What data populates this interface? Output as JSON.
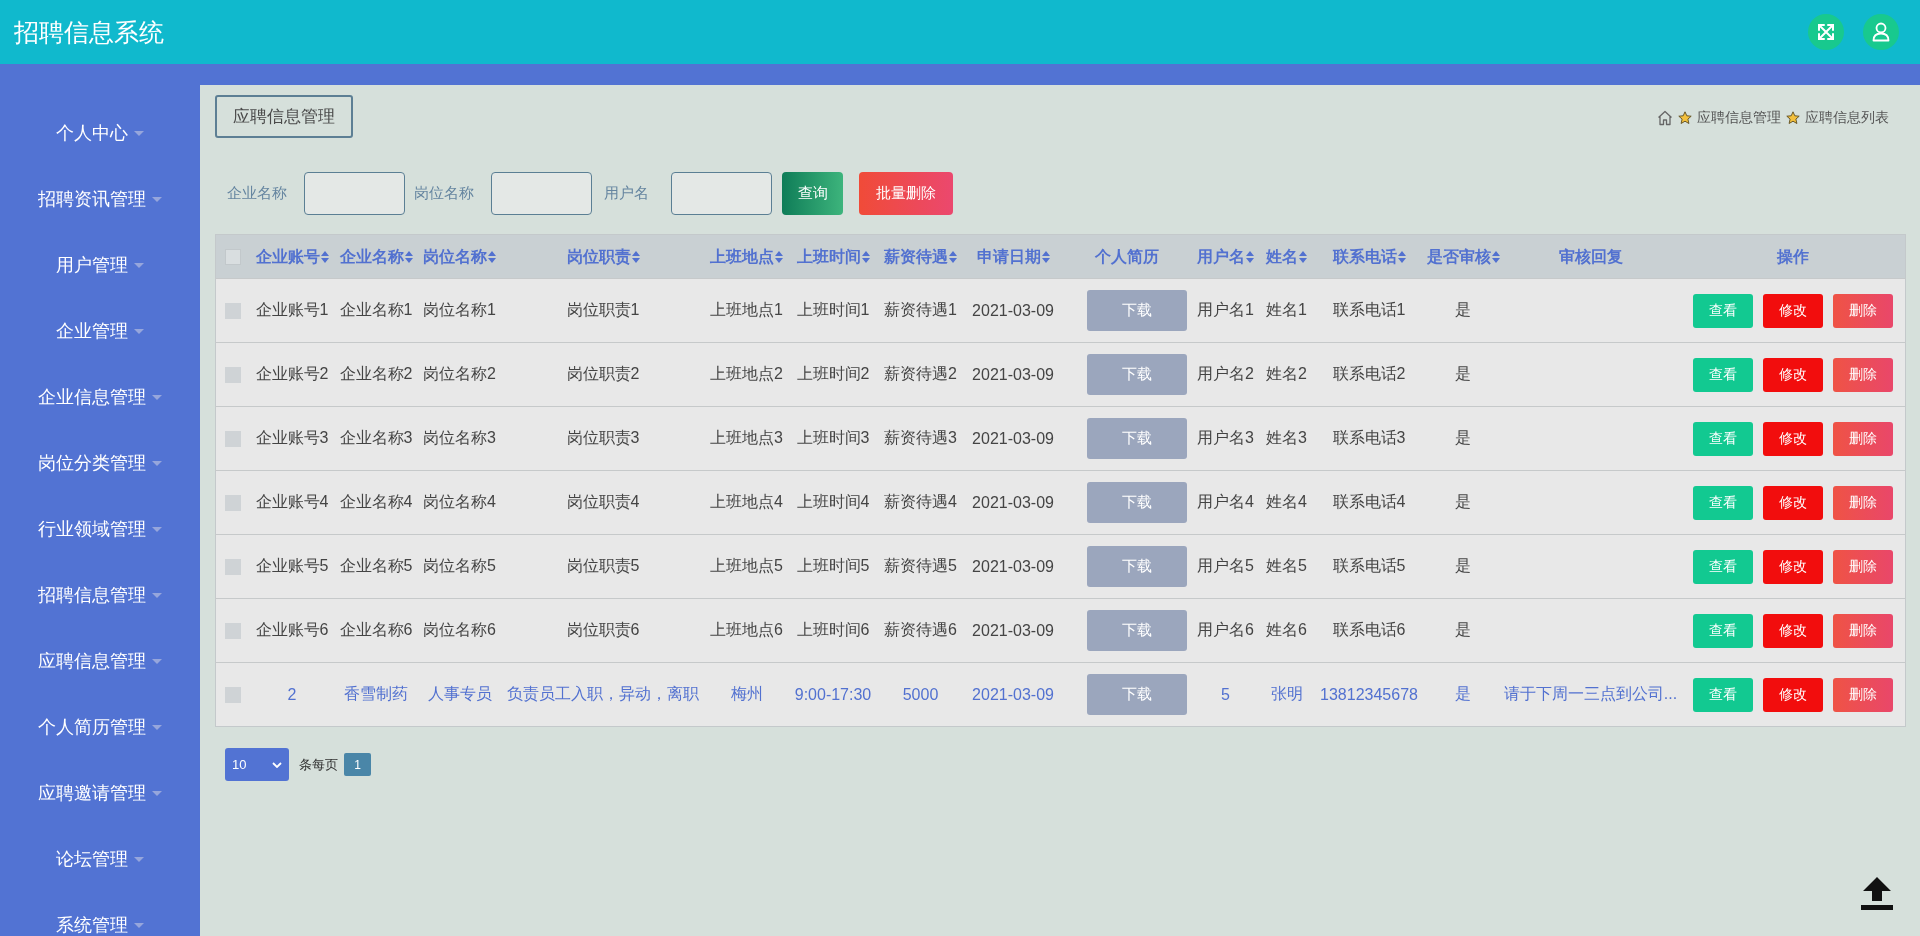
{
  "app": {
    "title": "招聘信息系统"
  },
  "sidebar": {
    "items": [
      {
        "label": "个人中心"
      },
      {
        "label": "招聘资讯管理"
      },
      {
        "label": "用户管理"
      },
      {
        "label": "企业管理"
      },
      {
        "label": "企业信息管理"
      },
      {
        "label": "岗位分类管理"
      },
      {
        "label": "行业领域管理"
      },
      {
        "label": "招聘信息管理"
      },
      {
        "label": "应聘信息管理"
      },
      {
        "label": "个人简历管理"
      },
      {
        "label": "应聘邀请管理"
      },
      {
        "label": "论坛管理"
      },
      {
        "label": "系统管理"
      }
    ]
  },
  "page_title": "应聘信息管理",
  "breadcrumb": [
    {
      "label": "应聘信息管理"
    },
    {
      "label": "应聘信息列表"
    }
  ],
  "search": {
    "fields": [
      {
        "label": "企业名称"
      },
      {
        "label": "岗位名称"
      },
      {
        "label": "用户名"
      }
    ],
    "buttons": [
      {
        "label": "查询",
        "kind": "search"
      },
      {
        "label": "批量删除",
        "kind": "delete"
      }
    ]
  },
  "table": {
    "header_checked": false,
    "columns": [
      {
        "label": "企业账号",
        "sortable": true,
        "kind": "text"
      },
      {
        "label": "企业名称",
        "sortable": true,
        "kind": "text"
      },
      {
        "label": "岗位名称",
        "sortable": true,
        "kind": "text"
      },
      {
        "label": "岗位职责",
        "sortable": true,
        "kind": "text"
      },
      {
        "label": "上班地点",
        "sortable": true,
        "kind": "text"
      },
      {
        "label": "上班时间",
        "sortable": true,
        "kind": "text"
      },
      {
        "label": "薪资待遇",
        "sortable": true,
        "kind": "text"
      },
      {
        "label": "申请日期",
        "sortable": true,
        "kind": "text"
      },
      {
        "label": "个人简历",
        "sortable": false,
        "kind": "button"
      },
      {
        "label": "用户名",
        "sortable": true,
        "kind": "text"
      },
      {
        "label": "姓名",
        "sortable": true,
        "kind": "text"
      },
      {
        "label": "联系电话",
        "sortable": true,
        "kind": "text"
      },
      {
        "label": "是否审核",
        "sortable": true,
        "kind": "text"
      },
      {
        "label": "审核回复",
        "sortable": false,
        "kind": "text"
      },
      {
        "label": "操作",
        "sortable": false,
        "kind": "actions"
      }
    ],
    "rows": [
      {
        "checked": false,
        "hovered": false,
        "cells": [
          "企业账号1",
          "企业名称1",
          "岗位名称1",
          "岗位职责1",
          "上班地点1",
          "上班时间1",
          "薪资待遇1",
          "2021-03-09",
          "下载",
          "用户名1",
          "姓名1",
          "联系电话1",
          "是",
          null,
          null
        ],
        "actions": [
          {
            "label": "查看",
            "kind": "view"
          },
          {
            "label": "修改",
            "kind": "edit"
          },
          {
            "label": "删除",
            "kind": "delete"
          }
        ]
      },
      {
        "checked": false,
        "hovered": false,
        "cells": [
          "企业账号2",
          "企业名称2",
          "岗位名称2",
          "岗位职责2",
          "上班地点2",
          "上班时间2",
          "薪资待遇2",
          "2021-03-09",
          "下载",
          "用户名2",
          "姓名2",
          "联系电话2",
          "是",
          null,
          null
        ],
        "actions": [
          {
            "label": "查看",
            "kind": "view"
          },
          {
            "label": "修改",
            "kind": "edit"
          },
          {
            "label": "删除",
            "kind": "delete"
          }
        ]
      },
      {
        "checked": false,
        "hovered": false,
        "cells": [
          "企业账号3",
          "企业名称3",
          "岗位名称3",
          "岗位职责3",
          "上班地点3",
          "上班时间3",
          "薪资待遇3",
          "2021-03-09",
          "下载",
          "用户名3",
          "姓名3",
          "联系电话3",
          "是",
          null,
          null
        ],
        "actions": [
          {
            "label": "查看",
            "kind": "view"
          },
          {
            "label": "修改",
            "kind": "edit"
          },
          {
            "label": "删除",
            "kind": "delete"
          }
        ]
      },
      {
        "checked": false,
        "hovered": false,
        "cells": [
          "企业账号4",
          "企业名称4",
          "岗位名称4",
          "岗位职责4",
          "上班地点4",
          "上班时间4",
          "薪资待遇4",
          "2021-03-09",
          "下载",
          "用户名4",
          "姓名4",
          "联系电话4",
          "是",
          null,
          null
        ],
        "actions": [
          {
            "label": "查看",
            "kind": "view"
          },
          {
            "label": "修改",
            "kind": "edit"
          },
          {
            "label": "删除",
            "kind": "delete"
          }
        ]
      },
      {
        "checked": false,
        "hovered": false,
        "cells": [
          "企业账号5",
          "企业名称5",
          "岗位名称5",
          "岗位职责5",
          "上班地点5",
          "上班时间5",
          "薪资待遇5",
          "2021-03-09",
          "下载",
          "用户名5",
          "姓名5",
          "联系电话5",
          "是",
          null,
          null
        ],
        "actions": [
          {
            "label": "查看",
            "kind": "view"
          },
          {
            "label": "修改",
            "kind": "edit"
          },
          {
            "label": "删除",
            "kind": "delete"
          }
        ]
      },
      {
        "checked": false,
        "hovered": false,
        "cells": [
          "企业账号6",
          "企业名称6",
          "岗位名称6",
          "岗位职责6",
          "上班地点6",
          "上班时间6",
          "薪资待遇6",
          "2021-03-09",
          "下载",
          "用户名6",
          "姓名6",
          "联系电话6",
          "是",
          null,
          null
        ],
        "actions": [
          {
            "label": "查看",
            "kind": "view"
          },
          {
            "label": "修改",
            "kind": "edit"
          },
          {
            "label": "删除",
            "kind": "delete"
          }
        ]
      },
      {
        "checked": false,
        "hovered": true,
        "cells": [
          "2",
          "香雪制药",
          "人事专员",
          "负责员工入职，异动，离职",
          "梅州",
          "9:00-17:30",
          "5000",
          "2021-03-09",
          "下载",
          "5",
          "张明",
          "13812345678",
          "是",
          "请于下周一三点到公司...",
          null
        ],
        "actions": [
          {
            "label": "查看",
            "kind": "view"
          },
          {
            "label": "修改",
            "kind": "edit"
          },
          {
            "label": "删除",
            "kind": "delete"
          }
        ]
      }
    ]
  },
  "pagination": {
    "page_size": "10",
    "per_page_label": "条每页",
    "pages": [
      {
        "label": "1",
        "selected": true
      }
    ]
  }
}
